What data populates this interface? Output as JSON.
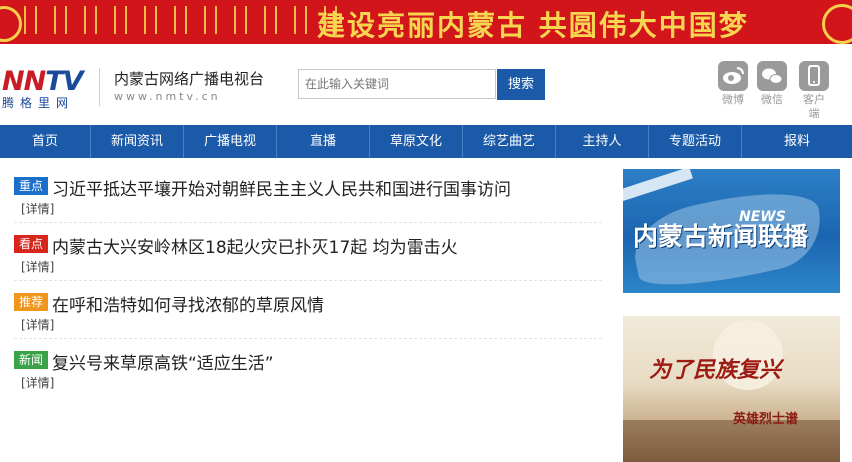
{
  "banner": {
    "slogan": "建设亮丽内蒙古  共圆伟大中国梦"
  },
  "header": {
    "logo_word_a": "NN",
    "logo_word_b": "TV",
    "logo_sub": "腾格里网",
    "site_name": "内蒙古网络广播电视台",
    "site_url": "www.nmtv.cn"
  },
  "search": {
    "placeholder": "在此输入关键词",
    "button_label": "搜索"
  },
  "social": [
    {
      "icon": "weibo-icon",
      "label": "微博"
    },
    {
      "icon": "wechat-icon",
      "label": "微信"
    },
    {
      "icon": "mobile-icon",
      "label": "客户端"
    }
  ],
  "nav": [
    "首页",
    "新闻资讯",
    "广播电视",
    "直播",
    "草原文化",
    "综艺曲艺",
    "主持人",
    "专题活动",
    "报料"
  ],
  "news": [
    {
      "tag": "重点",
      "tag_color": "#1b6fc9",
      "title": "习近平抵达平壤开始对朝鲜民主主义人民共和国进行国事访问",
      "detail": "[详情]"
    },
    {
      "tag": "看点",
      "tag_color": "#d9261c",
      "title": "内蒙古大兴安岭林区18起火灾已扑灭17起 均为雷击火",
      "detail": "[详情]"
    },
    {
      "tag": "推荐",
      "tag_color": "#f0961d",
      "title": "在呼和浩特如何寻找浓郁的草原风情",
      "detail": "[详情]"
    },
    {
      "tag": "新闻",
      "tag_color": "#3aa34a",
      "title": "复兴号来草原高铁“适应生活”",
      "detail": "[详情]"
    }
  ],
  "side_panels": {
    "panel1_title": "内蒙古新闻联播",
    "panel1_en": "NEWS",
    "panel2_title": "为了民族复兴",
    "panel2_sub": "英雄烈士谱"
  }
}
